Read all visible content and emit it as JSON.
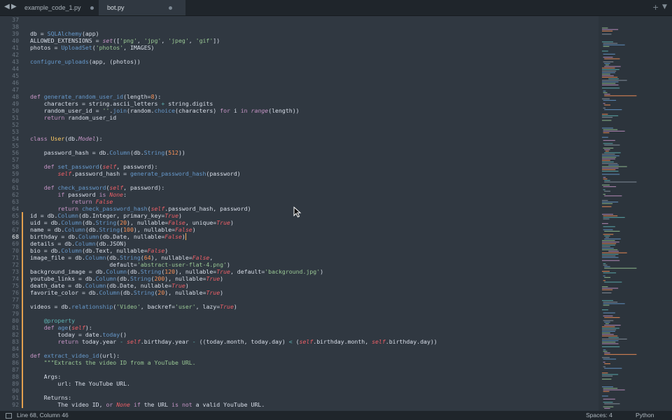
{
  "tabs": [
    {
      "label": "example_code_1.py",
      "active": false
    },
    {
      "label": "bot.py",
      "active": true
    }
  ],
  "status": {
    "position": "Line 68, Column 46",
    "indentation": "Spaces: 4",
    "syntax": "Python"
  },
  "colors": {
    "background": "#303841",
    "keyword": "#c594c5",
    "function": "#6699cc",
    "string": "#99c794",
    "constant": "#f99157",
    "builtin": "#ec5f67",
    "modified_marker": "#e3a04f"
  },
  "editor": {
    "current_line": "68",
    "lines": [
      {
        "n": "37",
        "code": ""
      },
      {
        "n": "38",
        "code": ""
      },
      {
        "n": "39",
        "code": "db = SQLAlchemy(app)"
      },
      {
        "n": "40",
        "code": "ALLOWED_EXTENSIONS = set(['png', 'jpg', 'jpeg', 'gif'])"
      },
      {
        "n": "41",
        "code": "photos = UploadSet('photos', IMAGES)"
      },
      {
        "n": "42",
        "code": ""
      },
      {
        "n": "43",
        "code": "configure_uploads(app, (photos))"
      },
      {
        "n": "44",
        "code": ""
      },
      {
        "n": "45",
        "code": ""
      },
      {
        "n": "46",
        "code": ""
      },
      {
        "n": "47",
        "code": ""
      },
      {
        "n": "48",
        "code": "def generate_random_user_id(length=8):"
      },
      {
        "n": "49",
        "code": "    characters = string.ascii_letters + string.digits"
      },
      {
        "n": "50",
        "code": "    random_user_id = ''.join(random.choice(characters) for i in range(length))"
      },
      {
        "n": "51",
        "code": "    return random_user_id"
      },
      {
        "n": "52",
        "code": ""
      },
      {
        "n": "53",
        "code": ""
      },
      {
        "n": "54",
        "code": "class User(db.Model):"
      },
      {
        "n": "55",
        "code": ""
      },
      {
        "n": "56",
        "code": "    password_hash = db.Column(db.String(512))"
      },
      {
        "n": "57",
        "code": ""
      },
      {
        "n": "58",
        "code": "    def set_password(self, password):"
      },
      {
        "n": "59",
        "code": "        self.password_hash = generate_password_hash(password)"
      },
      {
        "n": "60",
        "code": ""
      },
      {
        "n": "61",
        "code": "    def check_password(self, password):"
      },
      {
        "n": "62",
        "code": "        if password is None:"
      },
      {
        "n": "63",
        "code": "            return False"
      },
      {
        "n": "64",
        "code": "        return check_password_hash(self.password_hash, password)"
      },
      {
        "n": "65",
        "code": "id = db.Column(db.Integer, primary_key=True)"
      },
      {
        "n": "66",
        "code": "uid = db.Column(db.String(20), nullable=False, unique=True)"
      },
      {
        "n": "67",
        "code": "name = db.Column(db.String(100), nullable=False)"
      },
      {
        "n": "68",
        "code": "birthday = db.Column(db.Date, nullable=False)"
      },
      {
        "n": "69",
        "code": "details = db.Column(db.JSON)"
      },
      {
        "n": "70",
        "code": "bio = db.Column(db.Text, nullable=False)"
      },
      {
        "n": "71",
        "code": "image_file = db.Column(db.String(64), nullable=False,"
      },
      {
        "n": "72",
        "code": "                       default='abstract-user-flat-4.png')"
      },
      {
        "n": "73",
        "code": "background_image = db.Column(db.String(120), nullable=True, default='background.jpg')"
      },
      {
        "n": "74",
        "code": "youtube_links = db.Column(db.String(200), nullable=True)"
      },
      {
        "n": "75",
        "code": "death_date = db.Column(db.Date, nullable=True)"
      },
      {
        "n": "76",
        "code": "favorite_color = db.Column(db.String(20), nullable=True)"
      },
      {
        "n": "77",
        "code": ""
      },
      {
        "n": "78",
        "code": "videos = db.relationship('Video', backref='user', lazy=True)"
      },
      {
        "n": "79",
        "code": ""
      },
      {
        "n": "80",
        "code": "    @property"
      },
      {
        "n": "81",
        "code": "    def age(self):"
      },
      {
        "n": "82",
        "code": "        today = date.today()"
      },
      {
        "n": "83",
        "code": "        return today.year - self.birthday.year - ((today.month, today.day) < (self.birthday.month, self.birthday.day))"
      },
      {
        "n": "84",
        "code": ""
      },
      {
        "n": "85",
        "code": "def extract_video_id(url):"
      },
      {
        "n": "86",
        "code": "    \"\"\"Extracts the video ID from a YouTube URL."
      },
      {
        "n": "87",
        "code": ""
      },
      {
        "n": "88",
        "code": "    Args:"
      },
      {
        "n": "89",
        "code": "        url: The YouTube URL."
      },
      {
        "n": "90",
        "code": ""
      },
      {
        "n": "91",
        "code": "    Returns:"
      },
      {
        "n": "92",
        "code": "        The video ID, or None if the URL is not a valid YouTube URL."
      }
    ]
  }
}
